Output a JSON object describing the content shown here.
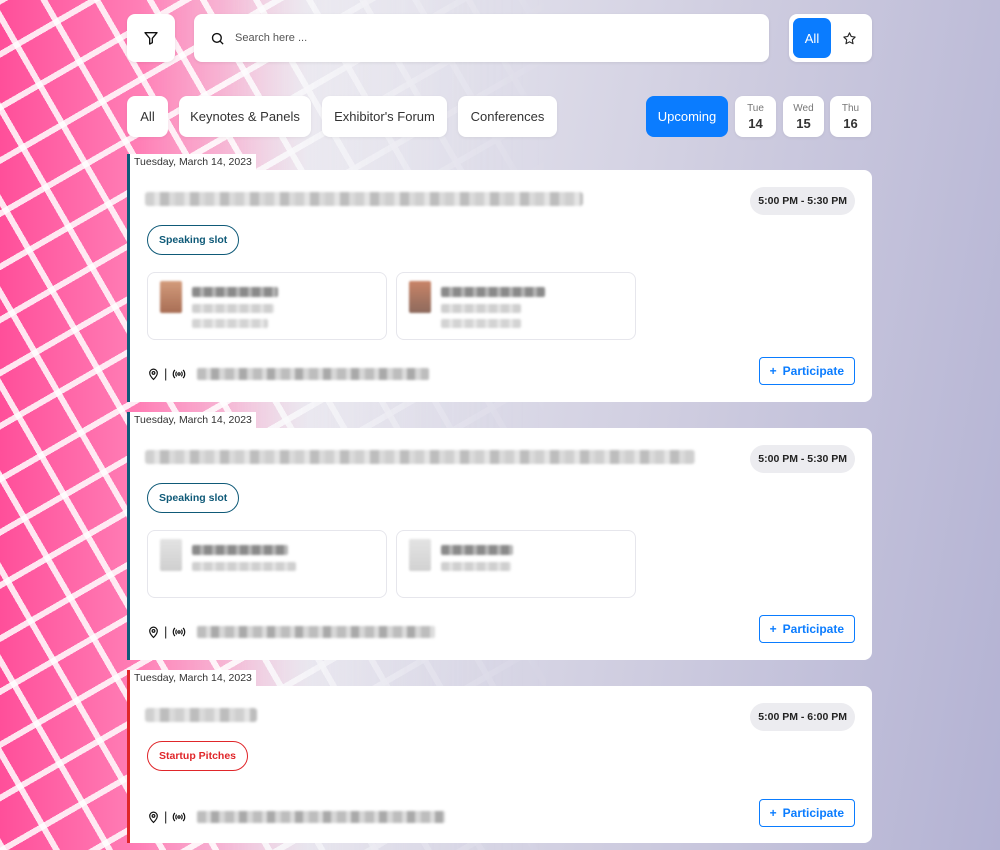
{
  "search": {
    "placeholder": "Search here ..."
  },
  "toggle": {
    "all_label": "All"
  },
  "categories": [
    {
      "label": "All"
    },
    {
      "label": "Keynotes & Panels"
    },
    {
      "label": "Exhibitor's Forum"
    },
    {
      "label": "Conferences"
    }
  ],
  "upcoming_label": "Upcoming",
  "days": [
    {
      "name": "Tue",
      "num": "14"
    },
    {
      "name": "Wed",
      "num": "15"
    },
    {
      "name": "Thu",
      "num": "16"
    }
  ],
  "colors": {
    "accent": "#0a7cff",
    "speaking": "#0f5a78",
    "startup": "#e0262a"
  },
  "events": [
    {
      "date": "Tuesday, March 14, 2023",
      "time": "5:00 PM - 5:30 PM",
      "tag": "Speaking slot",
      "participate_label": "Participate"
    },
    {
      "date": "Tuesday, March 14, 2023",
      "time": "5:00 PM - 5:30 PM",
      "tag": "Speaking slot",
      "participate_label": "Participate"
    },
    {
      "date": "Tuesday, March 14, 2023",
      "time": "5:00 PM - 6:00 PM",
      "tag": "Startup Pitches",
      "participate_label": "Participate"
    }
  ]
}
